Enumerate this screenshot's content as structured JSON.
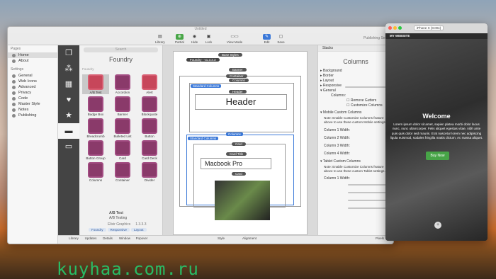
{
  "window": {
    "title": "Untitled"
  },
  "toolbar": {
    "library": "Library",
    "partial": "Partial",
    "hide": "Hide",
    "lock": "Lock",
    "view_mode": "View Mode",
    "edit": "Edit",
    "save": "Save",
    "publish": "Publishing Set"
  },
  "sidebar": {
    "pages_header": "Pages",
    "pages": [
      "Home",
      "About"
    ],
    "settings_header": "Settings",
    "settings": [
      "General",
      "Web Icons",
      "Advanced",
      "Privacy",
      "Code",
      "Master Style",
      "Notes",
      "Publishing"
    ]
  },
  "library": {
    "search": "Search",
    "title": "Foundry",
    "subtitle": "Foundry",
    "items": [
      "A/B Test",
      "Accordion",
      "Alert",
      "Badge Box",
      "Banner",
      "Blockquote",
      "Breadcrumb",
      "Bulleted List",
      "Button",
      "Button Group",
      "Card",
      "Card Deck",
      "Columns",
      "Container",
      "Divider"
    ],
    "footer_name": "A/B Test",
    "footer_desc": "A/B Testing",
    "publisher": "Elixir Graphics",
    "version": "1.3.3.3",
    "tags": [
      "Foundry",
      "Responsive",
      "Layout"
    ]
  },
  "bottombar": [
    "Library",
    "Updates",
    "Details",
    "Window",
    "Popover",
    "Style",
    "Alignment",
    "Pixels"
  ],
  "canvas": {
    "base_styles": "Base Styles",
    "foundry": "Foundry - v1.3.3.3",
    "banner": "Banner",
    "container": "Container",
    "columns": "Columns",
    "standard_columns": "Standard Columns",
    "header_label": "Header",
    "header_text": "Header",
    "card": "Card",
    "card_title": "Card Title",
    "card_title_text": "Macbook Pro",
    "card2": "Card"
  },
  "inspector": {
    "tab": "Stacks",
    "title": "Columns",
    "sections": [
      "Background",
      "Border",
      "Layout",
      "Responsive",
      "General"
    ],
    "columns_label": "Columns:",
    "remove_gutters": "Remove Gutters",
    "customize": "Customize Columns",
    "mobile_header": "Mobile Custom Columns",
    "mobile_note": "Note: Enable Customize Columns feature above to use these custom Mobile settings.",
    "col_labels": [
      "Column 1 Width:",
      "Column 2 Width:",
      "Column 3 Width:",
      "Column 4 Width:"
    ],
    "tablet_header": "Tablet Custom Columns",
    "tablet_note": "Note: Enable Customize Columns feature above to use these custom Tablet settings."
  },
  "preview": {
    "device": "iPhone X (0.00x)",
    "site": "MY WEBSITE",
    "welcome": "Welcome",
    "body": "Lorem ipsum dolor sit amet, sapien platea morbi dolor lacus nunc, nunc ullamcorper. Felis aliquet egestas vitae, nibh ante quis quis dolor sed mauris. Erat nascetur lorem nec adipiscing ligula euismod, sodales fringilla mattis dictum, Ac massa aliquet.",
    "button": "Buy Now"
  },
  "watermark": "kuyhaa.com.ru"
}
